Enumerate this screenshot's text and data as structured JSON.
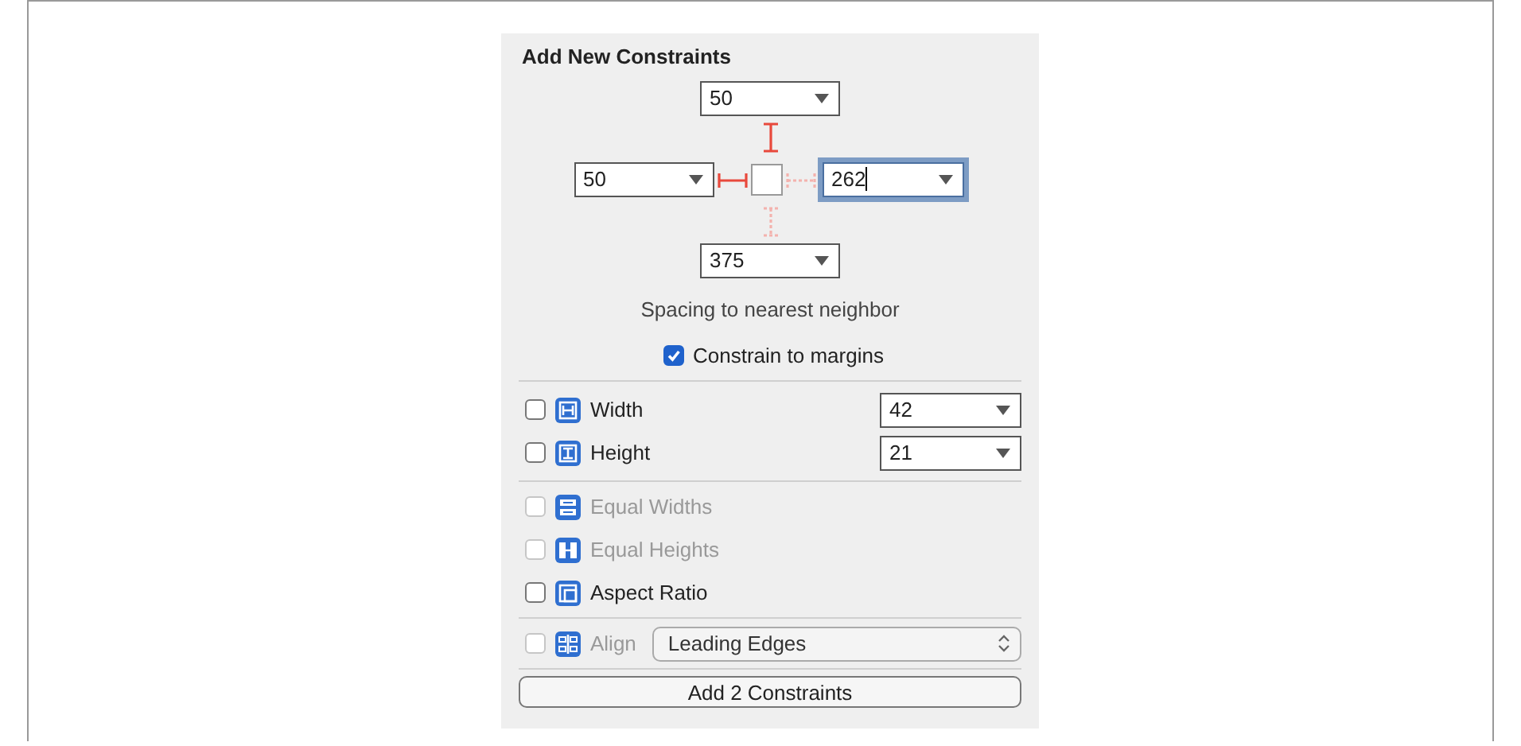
{
  "panel": {
    "title": "Add New Constraints",
    "spacing": {
      "top": {
        "value": "50",
        "active": true,
        "focused": false
      },
      "left": {
        "value": "50",
        "active": true,
        "focused": false
      },
      "right": {
        "value": "262",
        "active": false,
        "focused": true
      },
      "bottom": {
        "value": "375",
        "active": false,
        "focused": false
      }
    },
    "spacing_caption": "Spacing to nearest neighbor",
    "constrain_to_margins": {
      "label": "Constrain to margins",
      "checked": true
    },
    "size_rows": [
      {
        "kind": "width",
        "label": "Width",
        "checked": false,
        "disabled": false,
        "value": "42"
      },
      {
        "kind": "height",
        "label": "Height",
        "checked": false,
        "disabled": false,
        "value": "21"
      }
    ],
    "relation_rows": [
      {
        "kind": "equal_widths",
        "label": "Equal Widths",
        "checked": false,
        "disabled": true
      },
      {
        "kind": "equal_heights",
        "label": "Equal Heights",
        "checked": false,
        "disabled": true
      },
      {
        "kind": "aspect_ratio",
        "label": "Aspect Ratio",
        "checked": false,
        "disabled": false
      }
    ],
    "align": {
      "label": "Align",
      "checked": false,
      "disabled": true,
      "popup": "Leading Edges"
    },
    "add_button": "Add 2 Constraints"
  }
}
